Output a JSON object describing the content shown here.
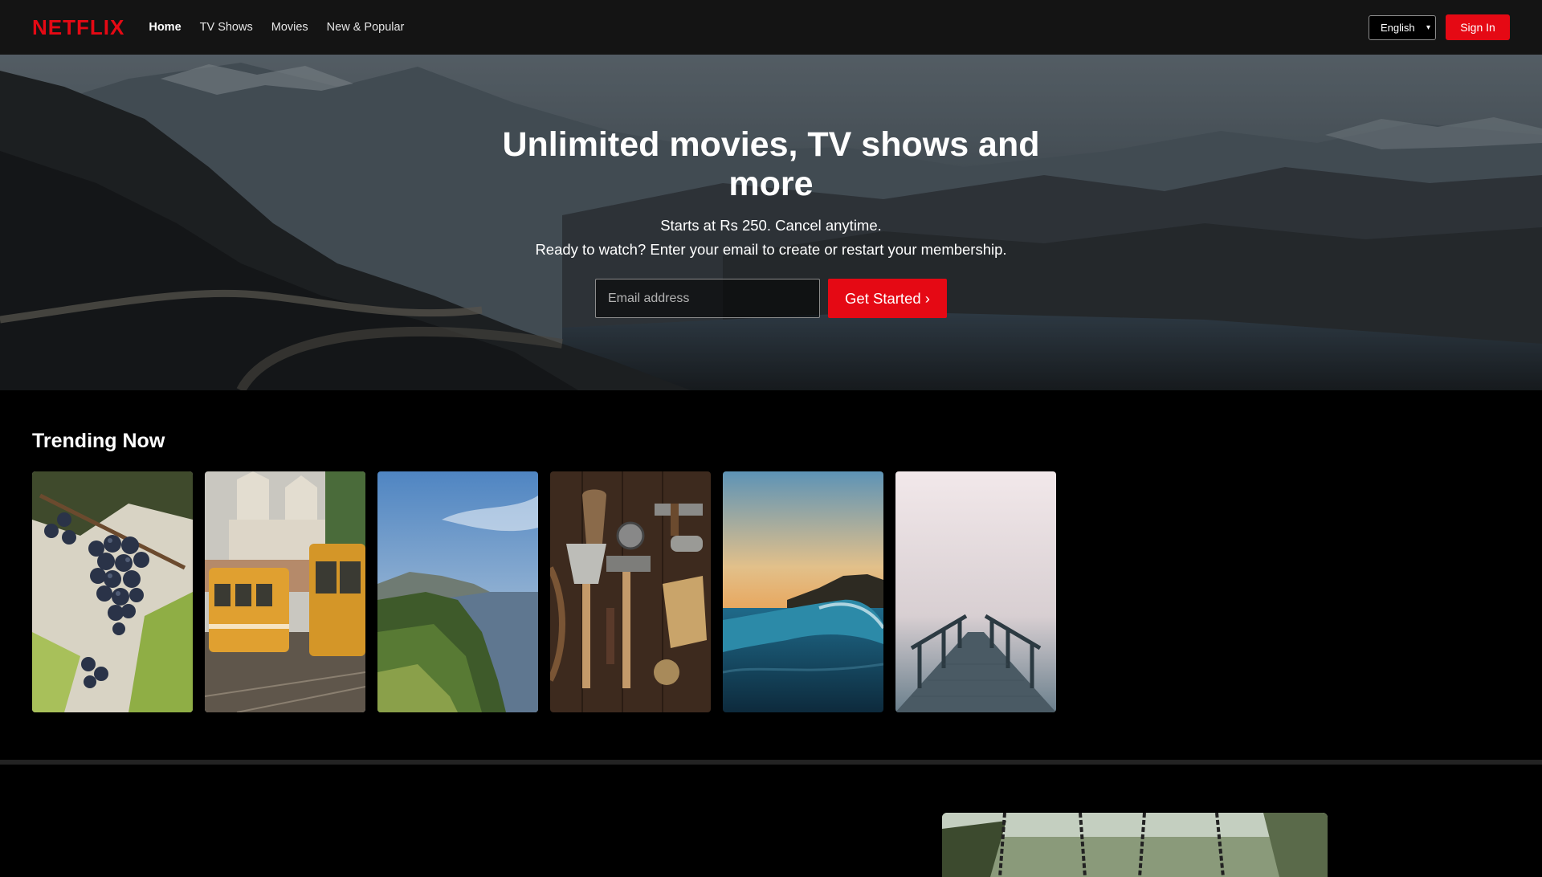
{
  "nav": {
    "logo": "NETFLIX",
    "links": [
      {
        "label": "Home",
        "active": true
      },
      {
        "label": "TV Shows",
        "active": false
      },
      {
        "label": "Movies",
        "active": false
      },
      {
        "label": "New & Popular",
        "active": false
      }
    ],
    "language": "English",
    "sign_in": "Sign In"
  },
  "hero": {
    "title": "Unlimited movies, TV shows and more",
    "subtitle": "Starts at Rs 250. Cancel anytime.",
    "prompt": "Ready to watch? Enter your email to create or restart your membership.",
    "email_placeholder": "Email address",
    "cta": "Get Started ›"
  },
  "trending": {
    "title": "Trending Now",
    "cards": [
      "grapes",
      "tram",
      "coast",
      "tools",
      "wave",
      "pier"
    ]
  },
  "colors": {
    "brand_red": "#e50914",
    "nav_bg": "#141414",
    "page_bg": "#000000"
  }
}
